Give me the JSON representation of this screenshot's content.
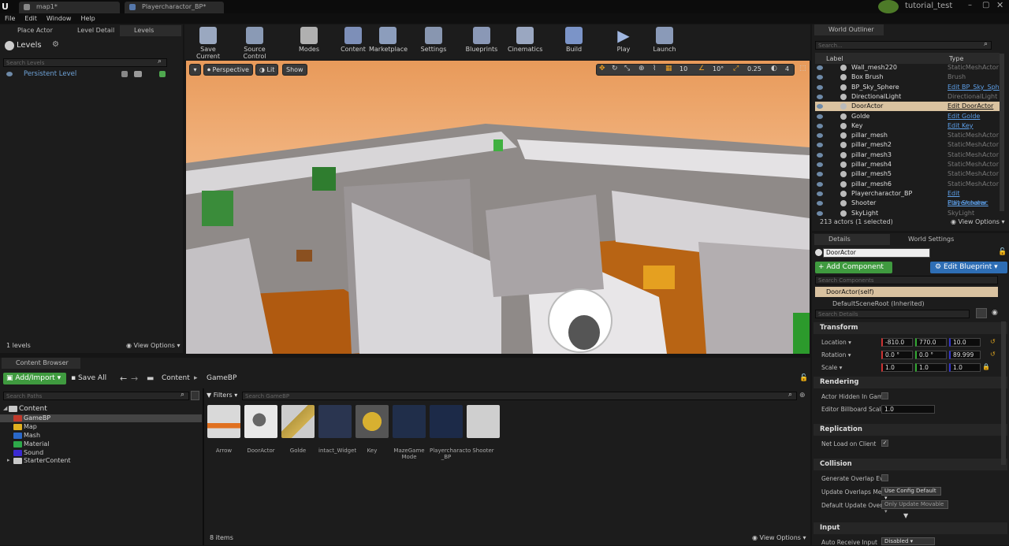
{
  "window": {
    "tabs": [
      "map1*",
      "Playercharactor_BP*"
    ],
    "project_name": "tutorial_test"
  },
  "menu": [
    "File",
    "Edit",
    "Window",
    "Help"
  ],
  "left_panel": {
    "tabs": [
      "Place Actor",
      "Level Detail",
      "Levels"
    ],
    "title": "Levels",
    "search_placeholder": "Search Levels",
    "persistent_level": "Persistent Level",
    "level_count": "1 levels",
    "view_options": "View Options"
  },
  "toolbar": {
    "buttons": [
      "Save Current",
      "Source Control",
      "Modes",
      "Content",
      "Marketplace",
      "Settings",
      "Blueprints",
      "Cinematics",
      "Build",
      "Play",
      "Launch"
    ]
  },
  "viewport": {
    "perspective": "Perspective",
    "lit": "Lit",
    "show": "Show",
    "grid_snap": "10",
    "rotation_snap": "10°",
    "scale_snap": "0.25",
    "camera_speed": "4"
  },
  "outliner": {
    "tab": "World Outliner",
    "search_placeholder": "Search...",
    "col_label": "Label",
    "col_type": "Type",
    "rows": [
      {
        "name": "Wall_mesh220",
        "type": "StaticMeshActor",
        "link": false
      },
      {
        "name": "Box Brush",
        "type": "Brush",
        "link": false
      },
      {
        "name": "BP_Sky_Sphere",
        "type": "Edit BP_Sky_Sph",
        "link": true
      },
      {
        "name": "DirectionalLight",
        "type": "DirectionalLight",
        "link": false
      },
      {
        "name": "DoorActor",
        "type": "Edit DoorActor",
        "link": true,
        "selected": true
      },
      {
        "name": "Golde",
        "type": "Edit Golde",
        "link": true
      },
      {
        "name": "Key",
        "type": "Edit Key",
        "link": true
      },
      {
        "name": "pillar_mesh",
        "type": "StaticMeshActor",
        "link": false
      },
      {
        "name": "pillar_mesh2",
        "type": "StaticMeshActor",
        "link": false
      },
      {
        "name": "pillar_mesh3",
        "type": "StaticMeshActor",
        "link": false
      },
      {
        "name": "pillar_mesh4",
        "type": "StaticMeshActor",
        "link": false
      },
      {
        "name": "pillar_mesh5",
        "type": "StaticMeshActor",
        "link": false
      },
      {
        "name": "pillar_mesh6",
        "type": "StaticMeshActor",
        "link": false
      },
      {
        "name": "Playercharactor_BP",
        "type": "Edit Playercharac",
        "link": true
      },
      {
        "name": "Shooter",
        "type": "Edit Shooter",
        "link": true
      },
      {
        "name": "SkyLight",
        "type": "SkyLight",
        "link": false
      }
    ],
    "count": "213 actors (1 selected)",
    "view_options": "View Options"
  },
  "details": {
    "tabs": [
      "Details",
      "World Settings"
    ],
    "actor_name": "DoorActor",
    "add_component": "+ Add Component",
    "edit_blueprint": "Edit Blueprint",
    "search_components": "Search Components",
    "component_self": "DoorActor(self)",
    "default_scene_root": "DefaultSceneRoot (Inherited)",
    "search_details": "Search Details",
    "transform": "Transform",
    "location_label": "Location",
    "location": [
      "-810.0",
      "770.0",
      "10.0"
    ],
    "rotation_label": "Rotation",
    "rotation": [
      "0.0 °",
      "0.0 °",
      "89.999"
    ],
    "scale_label": "Scale",
    "scale": [
      "1.0",
      "1.0",
      "1.0"
    ],
    "rendering": "Rendering",
    "actor_hidden": "Actor Hidden In Game",
    "billboard_scale_label": "Editor Billboard Scale",
    "billboard_scale": "1.0",
    "replication": "Replication",
    "net_load": "Net Load on Client",
    "collision": "Collision",
    "gen_overlap": "Generate Overlap Eve",
    "update_overlaps_label": "Update Overlaps Metl",
    "update_overlaps": "Use Config Default",
    "default_update_label": "Default Update Overla",
    "default_update": "Only Update Movable",
    "input": "Input",
    "auto_receive_label": "Auto Receive Input",
    "auto_receive": "Disabled"
  },
  "content_browser": {
    "tab": "Content Browser",
    "add_import": "Add/Import",
    "save_all": "Save All",
    "path": [
      "Content",
      "GameBP"
    ],
    "search_paths": "Search Paths",
    "filters": "Filters",
    "search_assets": "Search GameBP",
    "tree": [
      "Content",
      "GameBP",
      "Map",
      "Mash",
      "Material",
      "Sound",
      "StarterContent"
    ],
    "assets": [
      "Arrow",
      "DoorActor",
      "Golde",
      "intact_Widget",
      "Key",
      "MazeGame Mode",
      "Playercharacto _BP",
      "Shooter"
    ],
    "item_count": "8 items",
    "view_options": "View Options"
  }
}
